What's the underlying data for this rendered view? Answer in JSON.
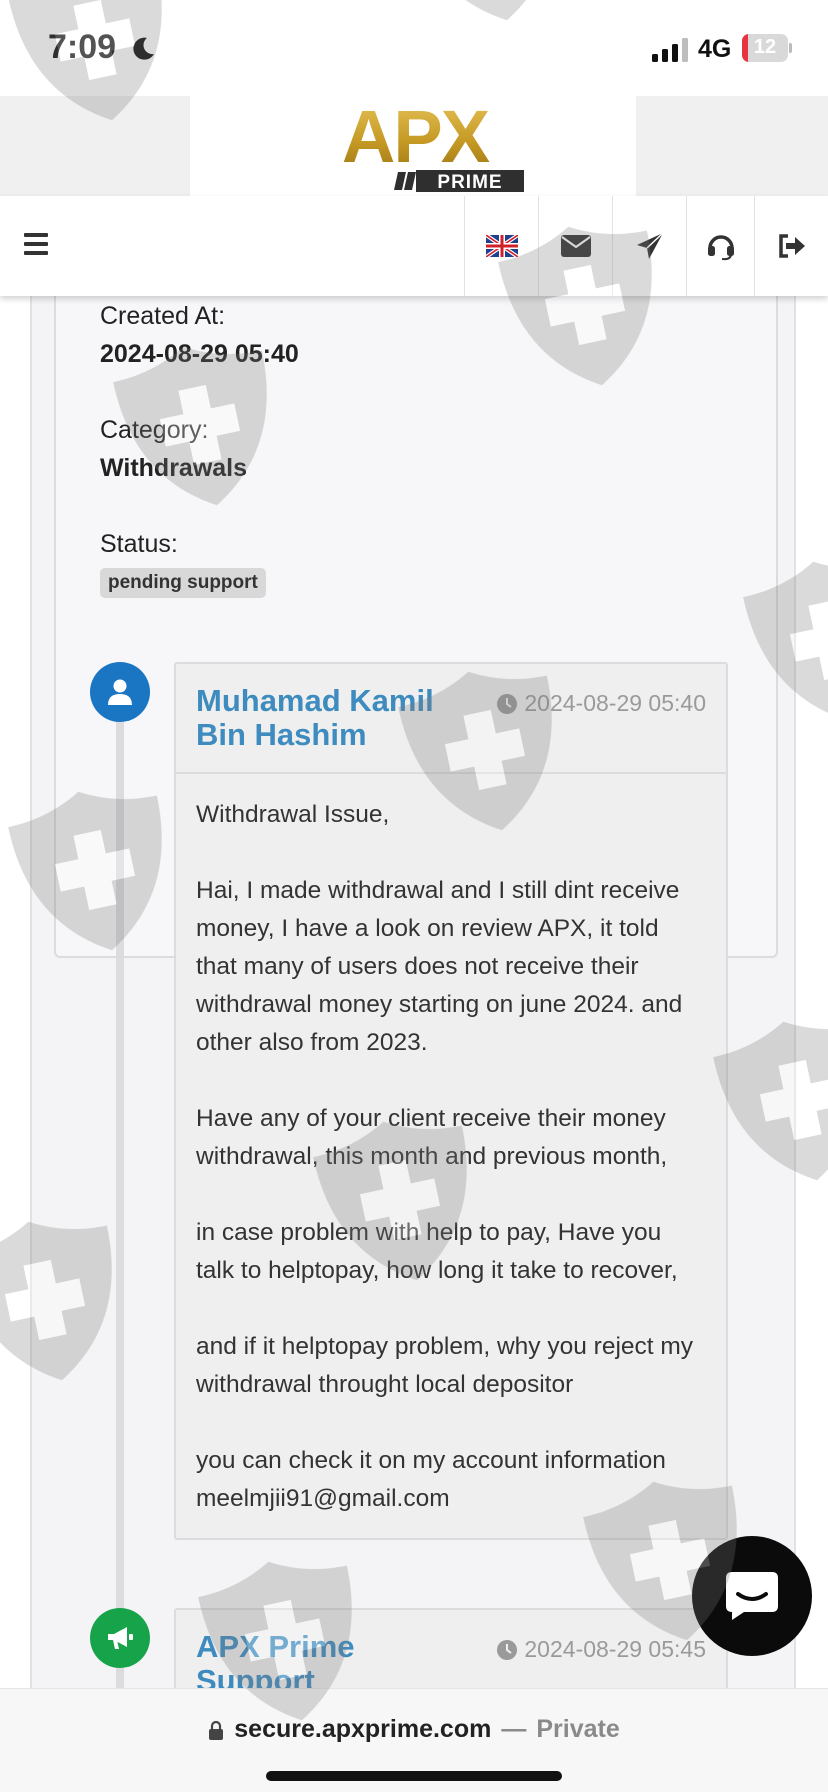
{
  "status_bar": {
    "time": "7:09",
    "network": "4G",
    "battery": "12",
    "battery_level": 0.12
  },
  "brand": {
    "logo_main": "APX",
    "logo_sub": "PRIME",
    "gold": "#c9a227",
    "dark": "#2f2f2f"
  },
  "nav": {
    "items": [
      {
        "icon": "uk-flag-icon"
      },
      {
        "icon": "envelope-icon"
      },
      {
        "icon": "paper-plane-icon"
      },
      {
        "icon": "headset-icon"
      },
      {
        "icon": "sign-out-icon"
      }
    ]
  },
  "ticket": {
    "created_label": "Created At:",
    "created_value": "2024-08-29 05:40",
    "category_label": "Category:",
    "category_value": "Withdrawals",
    "status_label": "Status:",
    "status_value": "pending support"
  },
  "messages": [
    {
      "author": "Muhamad Kamil Bin Hashim",
      "time": "2024-08-29 05:40",
      "icon": "user-icon",
      "icon_color": "#1a76c2",
      "paragraphs": [
        "Withdrawal Issue,",
        "Hai, I made withdrawal and I still dint receive money, I have a look on review APX, it told that many of users does not receive their withdrawal money starting on june 2024. and other also from 2023.",
        "Have any of your client receive their money withdrawal, this month and previous month,",
        "in case problem with help to pay, Have you talk to helptopay, how long it take to recover,",
        "and if it helptopay problem, why you reject my withdrawal throught local depositor",
        "you can check it on my account information meelmjii91@gmail.com"
      ]
    },
    {
      "author": "APX Prime Support",
      "time": "2024-08-29 05:45",
      "icon": "megaphone-icon",
      "icon_color": "#16a34a"
    }
  ],
  "browser": {
    "host": "secure.apxprime.com",
    "separator": "—",
    "mode": "Private"
  }
}
